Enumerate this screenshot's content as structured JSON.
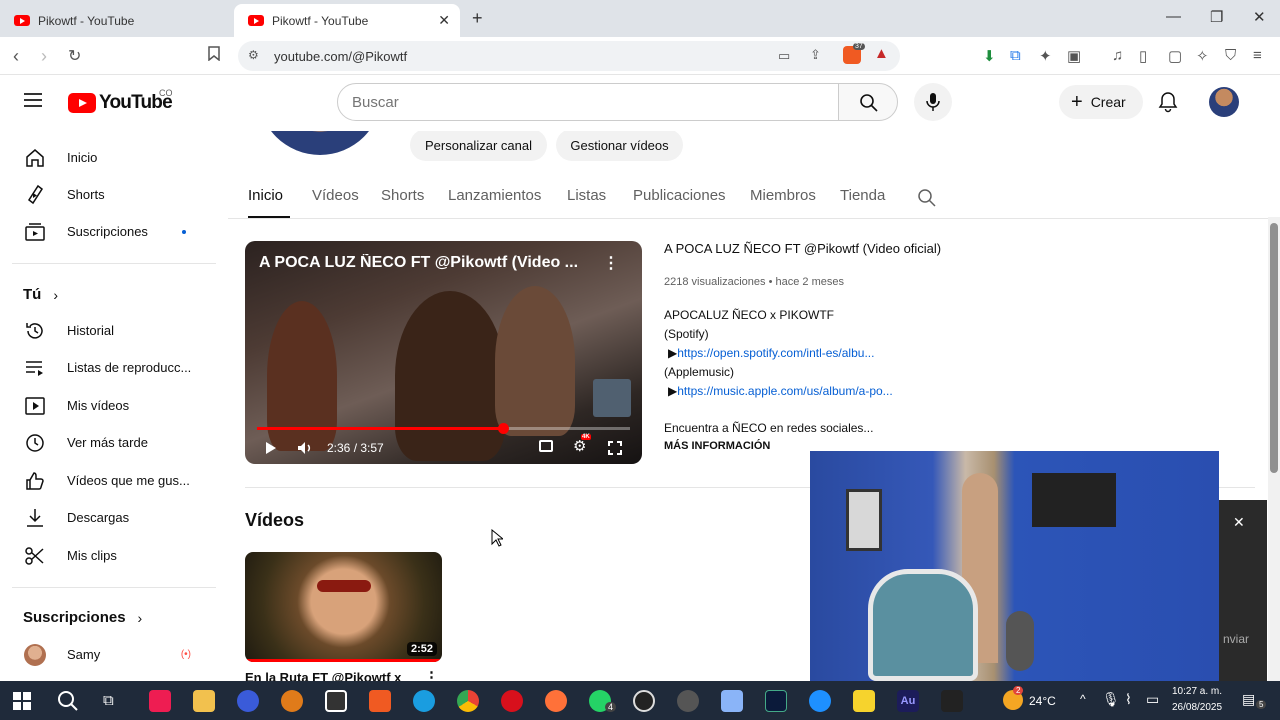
{
  "browser": {
    "tabs": [
      {
        "title": "Pikowtf - YouTube"
      },
      {
        "title": "Pikowtf - YouTube"
      }
    ],
    "new_tab_label": "+",
    "url": "youtube.com/@Pikowtf",
    "window_controls": {
      "minimize": "—",
      "maximize": "❐",
      "close": "✕"
    },
    "shield_badge": "37"
  },
  "yt": {
    "brand": "YouTube",
    "country": "CO",
    "search_placeholder": "Buscar",
    "create_label": "Crear",
    "colors": {
      "brand": "#ff0000",
      "link": "#065fd4",
      "tab_bar": "#dfe3e8"
    }
  },
  "sidebar": {
    "items": [
      {
        "label": "Inicio",
        "icon": "home-icon"
      },
      {
        "label": "Shorts",
        "icon": "shorts-icon"
      },
      {
        "label": "Suscripciones",
        "icon": "subscriptions-icon"
      }
    ],
    "you_section": "Tú",
    "you_items": [
      {
        "label": "Historial",
        "icon": "history-icon"
      },
      {
        "label": "Listas de reproducc...",
        "icon": "playlists-icon"
      },
      {
        "label": "Mis vídeos",
        "icon": "my-videos-icon"
      },
      {
        "label": "Ver más tarde",
        "icon": "clock-icon"
      },
      {
        "label": "Vídeos que me gus...",
        "icon": "thumbs-up-icon"
      },
      {
        "label": "Descargas",
        "icon": "download-icon"
      },
      {
        "label": "Mis clips",
        "icon": "scissors-icon"
      }
    ],
    "subs_section": "Suscripciones",
    "subs": [
      {
        "label": "Samy",
        "live": "(•)"
      }
    ]
  },
  "channel": {
    "buttons": [
      "Personalizar canal",
      "Gestionar vídeos"
    ],
    "tabs": [
      "Inicio",
      "Vídeos",
      "Shorts",
      "Lanzamientos",
      "Listas",
      "Publicaciones",
      "Miembros",
      "Tienda"
    ],
    "active_tab": "Inicio"
  },
  "featured": {
    "overlay_title": "A POCA LUZ ÑECO FT @Pikowtf (Video ...",
    "title": "A POCA LUZ ÑECO FT @Pikowtf (Video oficial)",
    "views": "2218 visualizaciones",
    "age": "hace 2 meses",
    "time": "2:36 / 3:57",
    "progress": 0.66,
    "hd_badge": "4K",
    "description": [
      {
        "text": "APOCALUZ ÑECO x PIKOWTF"
      },
      {
        "text": "(Spotify)"
      },
      {
        "prefix": "▶",
        "link": "https://open.spotify.com/intl-es/albu..."
      },
      {
        "text": "(Applemusic)"
      },
      {
        "prefix": "▶",
        "link": "https://music.apple.com/us/album/a-po..."
      },
      {
        "text": ""
      },
      {
        "text": "Encuentra a ÑECO en redes sociales..."
      }
    ],
    "more": "MÁS INFORMACIÓN"
  },
  "videos": {
    "heading": "Vídeos",
    "items": [
      {
        "title": "En la Ruta FT @Pikowtf x",
        "duration": "2:52"
      }
    ]
  },
  "overlay": {
    "close": "✕",
    "partial_text": "nviar"
  },
  "taskbar": {
    "temperature": "24°C",
    "weather_badge": "2",
    "time": "10:27 a. m.",
    "date": "26/08/2025",
    "whatsapp_badge": "4",
    "notif_count": "5"
  }
}
